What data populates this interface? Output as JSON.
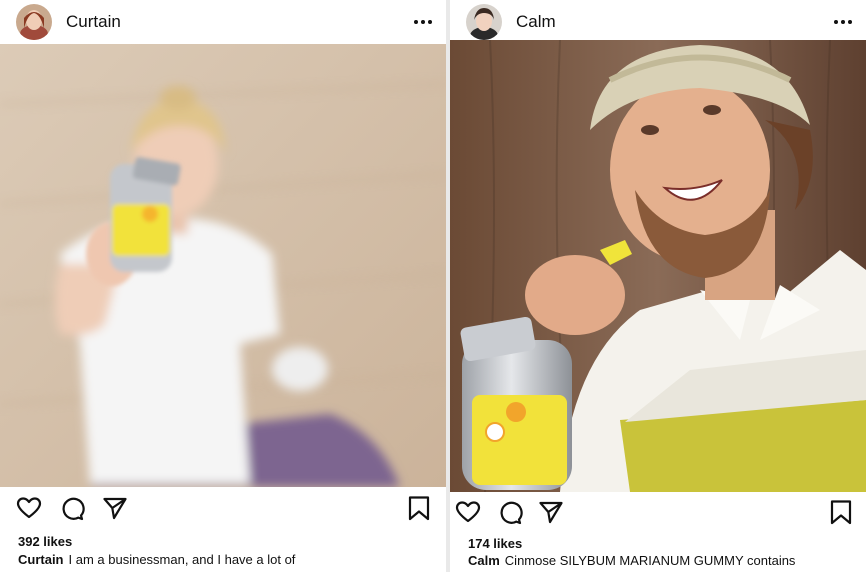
{
  "left_post": {
    "username": "Curtain",
    "likes": "392 likes",
    "caption_user": "Curtain",
    "caption_text": "I am a businessman, and I have a lot of",
    "icons": [
      "avatar",
      "more-icon",
      "heart-icon",
      "comment-icon",
      "share-icon",
      "bookmark-icon"
    ]
  },
  "right_post": {
    "username": "Calm",
    "likes": "174 likes",
    "caption_user": "Calm",
    "caption_text": "Cinmose SILYBUM MARIANUM GUMMY contains",
    "icons": [
      "avatar",
      "more-icon",
      "heart-icon",
      "comment-icon",
      "share-icon",
      "bookmark-icon"
    ]
  },
  "colors": {
    "text": "#111111",
    "background_gap": "#e9e9e9",
    "product_yellow": "#f2e23a",
    "product_silver": "#b9bcc2"
  }
}
